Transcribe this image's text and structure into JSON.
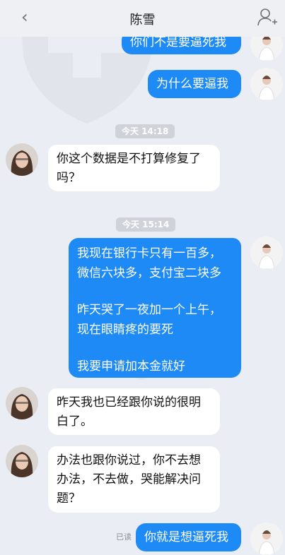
{
  "header": {
    "title": "陈雪",
    "back_icon": "chevron-left-icon",
    "right_icon": "add-contact-icon"
  },
  "messages": [
    {
      "dir": "out",
      "text": "你们不是要逼死我"
    },
    {
      "dir": "out",
      "text": "为什么要逼我"
    },
    {
      "type": "time",
      "text": "今天 14:18"
    },
    {
      "dir": "in",
      "text": "你这个数据是不打算修复了吗？"
    },
    {
      "type": "time",
      "text": "今天 15:14"
    },
    {
      "dir": "out",
      "paragraphs": [
        "我现在银行卡只有一百多，微信六块多，支付宝二块多",
        "昨天哭了一夜加一个上午，现在眼睛疼的要死",
        "我要申请加本金就好"
      ]
    },
    {
      "dir": "in",
      "text": "昨天我也已经跟你说的很明白了。"
    },
    {
      "dir": "in",
      "text": "办法也跟你说过，你不去想办法，不去做，哭能解决问题？"
    },
    {
      "dir": "out",
      "text": "你就是想逼死我",
      "status": "已读"
    }
  ],
  "colors": {
    "outgoing_bubble": "#1e8af5",
    "incoming_bubble": "#ffffff",
    "background": "#eaedf3"
  }
}
